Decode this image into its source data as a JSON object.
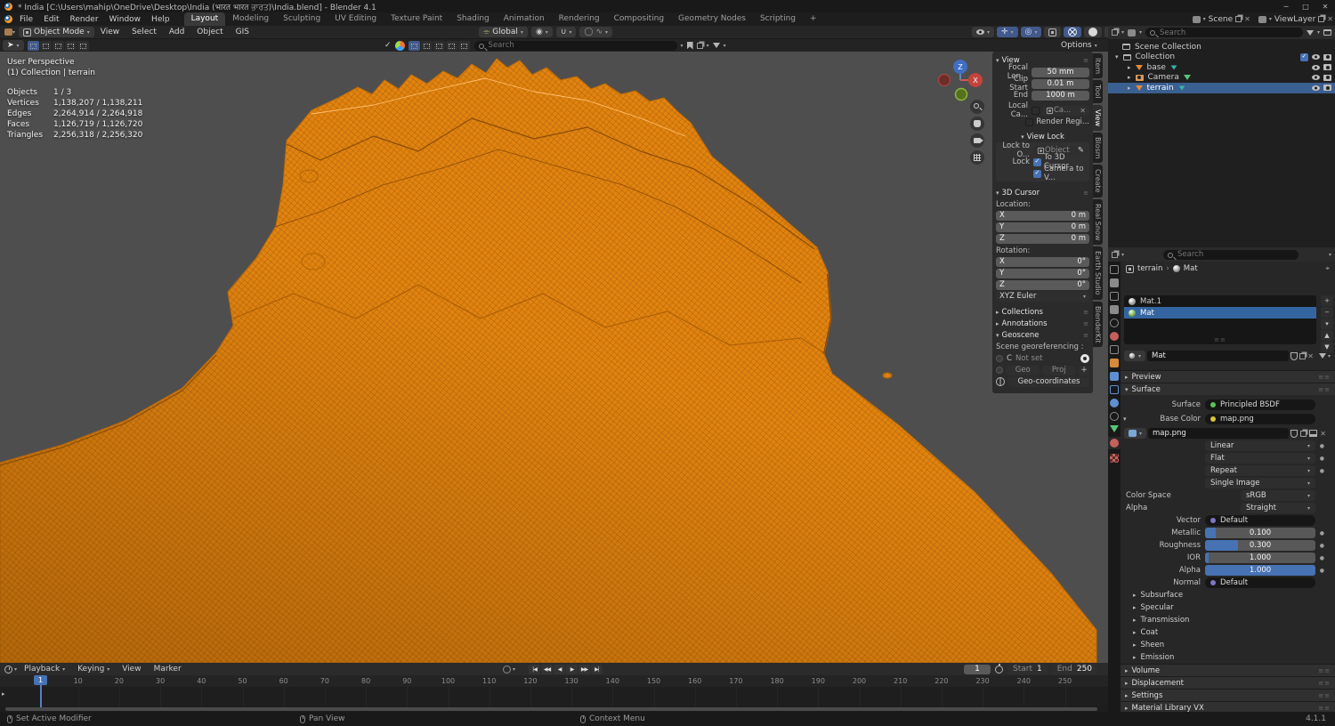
{
  "window": {
    "title": "* India [C:\\Users\\mahip\\OneDrive\\Desktop\\India (भारत भारत ਭਾਰਤ)\\India.blend] - Blender 4.1",
    "controls": {
      "minimize": "─",
      "maximize": "□",
      "close": "✕"
    }
  },
  "topbar": {
    "menus": [
      "File",
      "Edit",
      "Render",
      "Window",
      "Help"
    ],
    "workspaces": [
      "Layout",
      "Modeling",
      "Sculpting",
      "UV Editing",
      "Texture Paint",
      "Shading",
      "Animation",
      "Rendering",
      "Compositing",
      "Geometry Nodes",
      "Scripting",
      "+"
    ],
    "active_workspace": "Layout",
    "scene_name": "Scene",
    "view_layer_name": "ViewLayer"
  },
  "viewport_header": {
    "mode": "Object Mode",
    "menus": [
      "View",
      "Select",
      "Add",
      "Object",
      "GIS"
    ],
    "orientation": "Global",
    "options_label": "Options",
    "search_placeholder": "Search"
  },
  "viewport_overlay": {
    "perspective": "User Perspective",
    "context": "(1) Collection | terrain",
    "stats": [
      {
        "label": "Objects",
        "value": "1 / 3"
      },
      {
        "label": "Vertices",
        "value": "1,138,207 / 1,138,211"
      },
      {
        "label": "Edges",
        "value": "2,264,914 / 2,264,918"
      },
      {
        "label": "Faces",
        "value": "1,126,719 / 1,126,720"
      },
      {
        "label": "Triangles",
        "value": "2,256,318 / 2,256,320"
      }
    ]
  },
  "npanel": {
    "tabs": [
      "Item",
      "Tool",
      "View",
      "Blosm",
      "Create",
      "Real Snow",
      "Earth Studio",
      "BlenderKit"
    ],
    "active_tab": "View",
    "view": {
      "title": "View",
      "focal_label": "Focal Len...",
      "focal_value": "50 mm",
      "clip_start_label": "Clip Start",
      "clip_start_value": "0.01 m",
      "clip_end_label": "End",
      "clip_end_value": "1000 m",
      "local_camera_label": "Local Ca...",
      "local_camera_value": "Ca...",
      "render_region_label": "Render Regi..."
    },
    "view_lock": {
      "title": "View Lock",
      "lock_to_label": "Lock to O...",
      "lock_to_value": "Object",
      "lock_label": "Lock",
      "to_3d_cursor": "To 3D Cursor",
      "camera_to_view": "Camera to V..."
    },
    "cursor": {
      "title": "3D Cursor",
      "location_label": "Location:",
      "rotation_label": "Rotation:",
      "axes": [
        "X",
        "Y",
        "Z"
      ],
      "location": [
        "0 m",
        "0 m",
        "0 m"
      ],
      "rotation": [
        "0°",
        "0°",
        "0°"
      ],
      "euler": "XYZ Euler"
    },
    "collections_title": "Collections",
    "annotations_title": "Annotations",
    "geoscene": {
      "title": "Geoscene",
      "georef_label": "Scene georeferencing :",
      "crs_code": "C",
      "crs_value": "Not set",
      "geo": "Geo",
      "proj": "Proj",
      "add": "+",
      "geo_coordinates": "Geo-coordinates"
    }
  },
  "outliner": {
    "search_placeholder": "Search",
    "root": "Scene Collection",
    "collection": "Collection",
    "items": [
      "base",
      "Camera",
      "terrain"
    ],
    "selected_item": "terrain"
  },
  "properties": {
    "search_placeholder": "Search",
    "breadcrumb": {
      "object": "terrain",
      "material": "Mat",
      "separator": "›"
    },
    "slots": [
      "Mat.1",
      "Mat"
    ],
    "selected_slot": "Mat",
    "slot_buttons": [
      "+",
      "−",
      "▾",
      "▲",
      "▼"
    ],
    "material_name": "Mat",
    "panels": {
      "preview": "Preview",
      "surface": "Surface",
      "volume": "Volume",
      "displacement": "Displacement",
      "settings": "Settings",
      "material_library": "Material Library VX"
    },
    "surface": {
      "surface_label": "Surface",
      "surface_value": "Principled BSDF",
      "base_color_label": "Base Color",
      "base_color_value": "map.png",
      "image_name": "map.png",
      "interpolation": "Linear",
      "projection": "Flat",
      "extension": "Repeat",
      "source": "Single Image",
      "color_space_label": "Color Space",
      "color_space_value": "sRGB",
      "alpha_mode_label": "Alpha",
      "alpha_mode_value": "Straight",
      "vector_label": "Vector",
      "vector_value": "Default",
      "sliders": [
        {
          "label": "Metallic",
          "value": "0.100",
          "fill": 10
        },
        {
          "label": "Roughness",
          "value": "0.300",
          "fill": 30
        },
        {
          "label": "IOR",
          "value": "1.000",
          "fill": 3
        },
        {
          "label": "Alpha",
          "value": "1.000",
          "fill": 100
        }
      ],
      "normal_label": "Normal",
      "normal_value": "Default",
      "subpanels": [
        "Subsurface",
        "Specular",
        "Transmission",
        "Coat",
        "Sheen",
        "Emission"
      ]
    }
  },
  "timeline": {
    "menus": [
      "Playback",
      "Keying",
      "View",
      "Marker"
    ],
    "transport": [
      "|◀",
      "◀◀",
      "◀",
      "▶",
      "▶▶",
      "▶|"
    ],
    "current_frame": "1",
    "start_label": "Start",
    "start_value": "1",
    "end_label": "End",
    "end_value": "250",
    "ticks": [
      10,
      20,
      30,
      40,
      50,
      60,
      70,
      80,
      90,
      100,
      110,
      120,
      130,
      140,
      150,
      160,
      170,
      180,
      190,
      200,
      210,
      220,
      230,
      240,
      250
    ]
  },
  "statusbar": {
    "hints": [
      "Set Active Modifier",
      "Pan View",
      "Context Menu"
    ],
    "version": "4.1.1"
  },
  "colors": {
    "accent": "#4772b3",
    "selection": "#3a5f91",
    "terrain": "#e1830f"
  }
}
